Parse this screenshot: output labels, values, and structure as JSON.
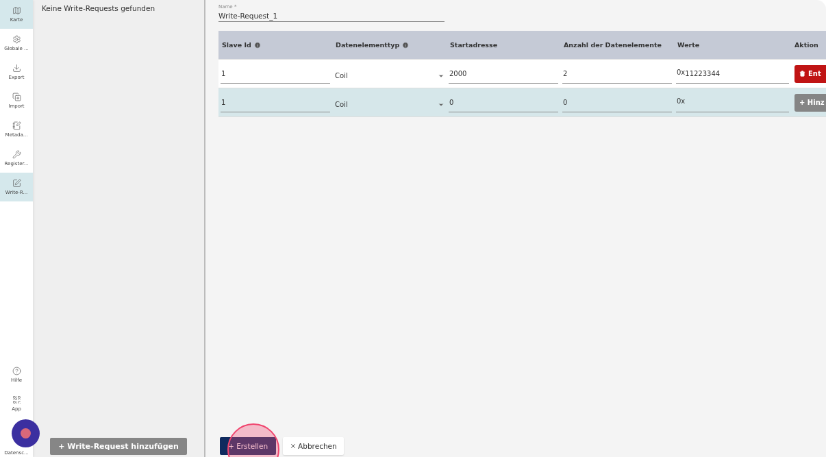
{
  "sidebar": {
    "items": [
      {
        "label": "Karte",
        "selected": true
      },
      {
        "label": "Globale ...",
        "selected": false
      },
      {
        "label": "Export",
        "selected": false
      },
      {
        "label": "Import",
        "selected": false
      },
      {
        "label": "Metada...",
        "selected": false
      },
      {
        "label": "Register...",
        "selected": false
      },
      {
        "label": "Write-R...",
        "selected": true
      }
    ],
    "bottom_items": [
      {
        "label": "Hilfe"
      },
      {
        "label": "App"
      },
      {
        "label": "Datensc..."
      }
    ]
  },
  "list_panel": {
    "empty_text": "Keine Write-Requests gefunden",
    "add_button": "+ Write-Request hinzufügen"
  },
  "form": {
    "name_label": "Name *",
    "name_value": "Write-Request_1",
    "table": {
      "columns": [
        {
          "label": "Slave Id",
          "info": true
        },
        {
          "label": "Datenelementtyp",
          "info": true
        },
        {
          "label": "Startadresse",
          "info": false
        },
        {
          "label": "Anzahl der Datenelemente",
          "info": false
        },
        {
          "label": "Werte",
          "info": false
        },
        {
          "label": "Aktion",
          "info": false
        }
      ],
      "rows": [
        {
          "slave_id": "1",
          "type": "Coil",
          "start": "2000",
          "count": "2",
          "prefix": "0x",
          "value": "11223344",
          "action": {
            "kind": "delete",
            "label": "Ent"
          },
          "highlighted": false
        },
        {
          "slave_id": "1",
          "type": "Coil",
          "start": "0",
          "count": "0",
          "prefix": "0x",
          "value": "",
          "action": {
            "kind": "add",
            "label": "+ Hinz"
          },
          "highlighted": true
        }
      ]
    },
    "create_button": "+ Erstellen",
    "cancel_button": "Abbrechen"
  }
}
